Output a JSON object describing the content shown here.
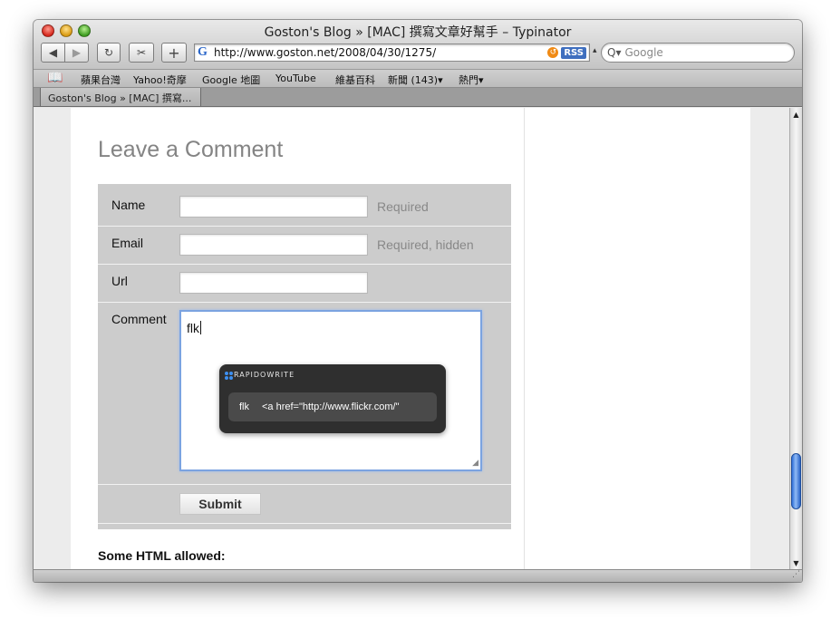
{
  "window": {
    "title": "Goston's Blog » [MAC] 撰寫文章好幫手 – Typinator"
  },
  "toolbar": {
    "back_glyph": "◀",
    "forward_glyph": "▶",
    "reload_glyph": "↻",
    "snip_glyph": "✂",
    "add_glyph": "+",
    "url_glyph": "G",
    "url": "http://www.goston.net/2008/04/30/1275/",
    "snapback_glyph": "↺",
    "rss_label": "RSS",
    "url_menu_glyph": "▴",
    "search_glyph": "Q▾",
    "search_placeholder": "Google"
  },
  "bookmarks": {
    "book_glyph": "📖",
    "items": [
      "蘋果台灣",
      "Yahoo!奇摩",
      "Google 地圖",
      "YouTube",
      "維基百科",
      "新聞 (143)▾",
      "熱門▾"
    ]
  },
  "tabs": [
    {
      "label": "Goston's Blog » [MAC] 撰寫..."
    }
  ],
  "page": {
    "heading": "Leave a Comment",
    "fields": {
      "name_label": "Name",
      "name_hint": "Required",
      "email_label": "Email",
      "email_hint": "Required, hidden",
      "url_label": "Url",
      "comment_label": "Comment",
      "comment_value": "flk"
    },
    "submit_label": "Submit",
    "html_allowed": "Some HTML allowed:"
  },
  "rapidowrite": {
    "brand": "RAPIDOWRITE",
    "suggestion_abbr": "flk",
    "suggestion_expansion": "<a href=\"http://www.flickr.com/\""
  },
  "scrollbar": {
    "up_glyph": "▲",
    "down_glyph": "▼"
  },
  "status": {
    "grip_glyph": "⋰"
  },
  "colors": {
    "focus_ring": "#7ba3e0",
    "popup_bg": "#2f2f2f",
    "scroll_thumb": "#2f6fd8",
    "rss_badge": "#3f6fbf"
  }
}
